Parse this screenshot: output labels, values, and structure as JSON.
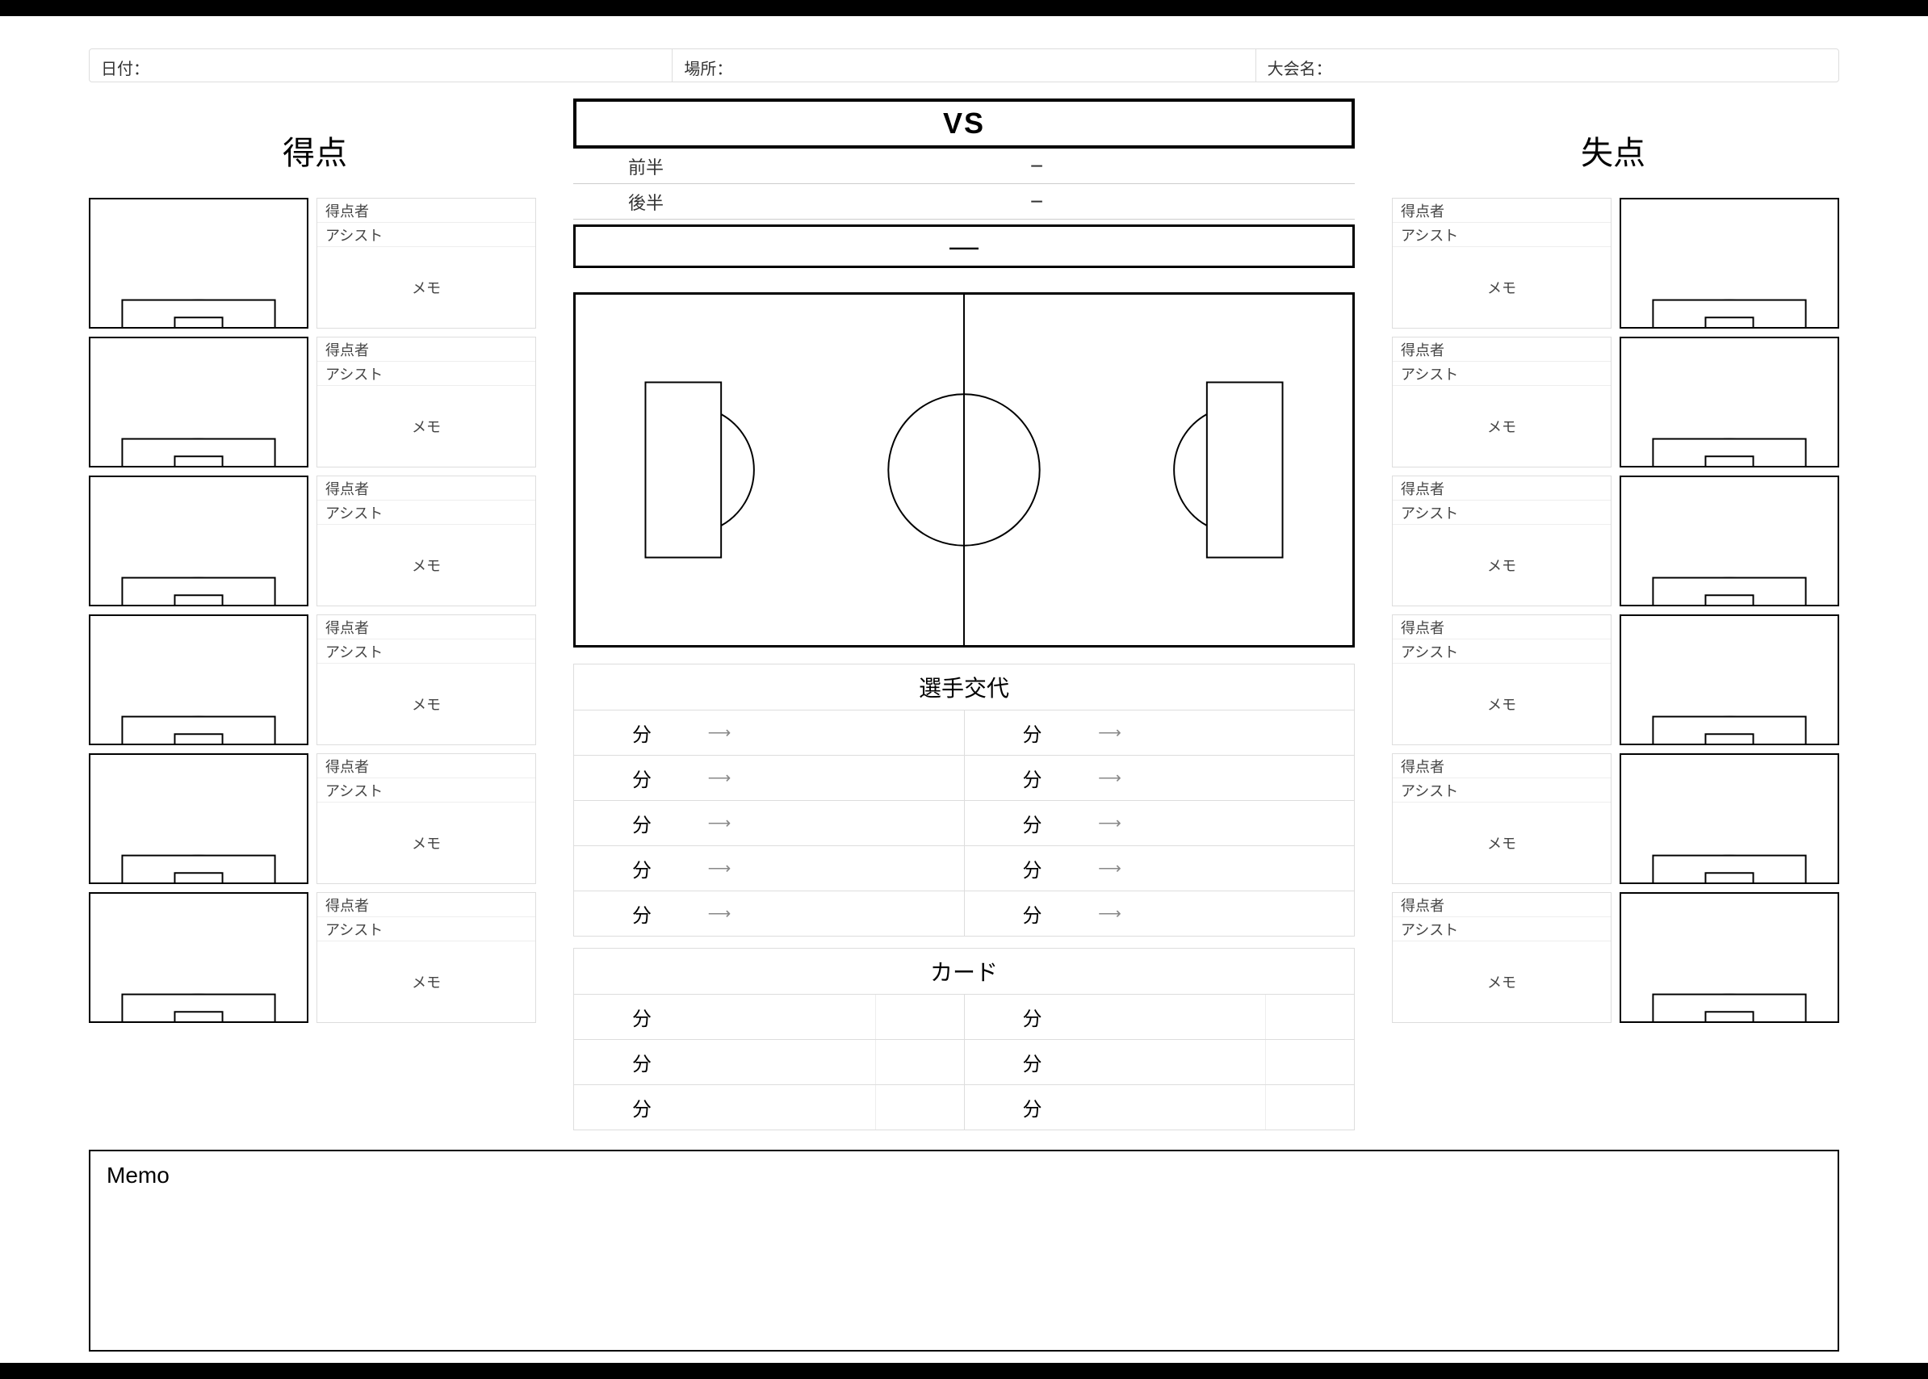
{
  "topbar": {
    "date_label": "日付：",
    "place_label": "場所：",
    "comp_label": "大会名："
  },
  "sides": {
    "left_title": "得点",
    "right_title": "失点",
    "scorer_label": "得点者",
    "assist_label": "アシスト",
    "memo_label": "メモ",
    "row_count": 6
  },
  "center": {
    "vs_label": "VS",
    "first_half_label": "前半",
    "second_half_label": "後半",
    "first_half_score": "−",
    "second_half_score": "−",
    "total_score": "—",
    "subs_title": "選手交代",
    "cards_title": "カード",
    "minute_label": "分",
    "arrow_glyph": "⟶",
    "sub_rows": 5,
    "card_rows": 3
  },
  "memo": {
    "label": "Memo"
  }
}
